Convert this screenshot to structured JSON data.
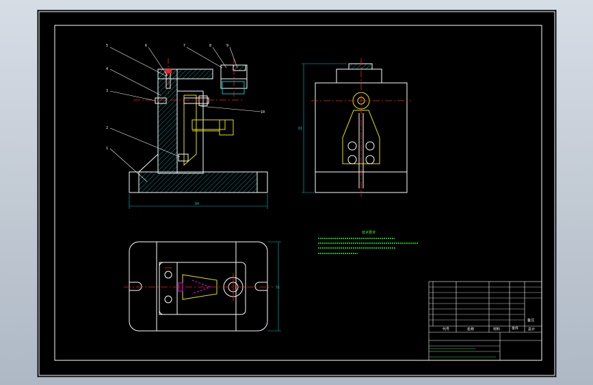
{
  "colors": {
    "background": "#000000",
    "frame": "#ffffff",
    "part_lines": "#ffffff",
    "hatch": "#00c8c8",
    "dimensions": "#00c8c8",
    "centerlines": "#ff2020",
    "subassembly": "#e8e800",
    "hidden": "#ff00ff",
    "notes_text": "#20ff20",
    "title_block": "#ffffff"
  },
  "front_view": {
    "balloons": [
      {
        "id": "b5",
        "label": "5"
      },
      {
        "id": "b6",
        "label": "6"
      },
      {
        "id": "b7",
        "label": "7"
      },
      {
        "id": "b8",
        "label": "8"
      },
      {
        "id": "b9",
        "label": "9"
      },
      {
        "id": "b4",
        "label": "4"
      },
      {
        "id": "b3",
        "label": "3"
      },
      {
        "id": "b10",
        "label": "10"
      },
      {
        "id": "b2",
        "label": "2"
      },
      {
        "id": "b1",
        "label": "1"
      }
    ],
    "width_dimension": "84"
  },
  "side_view": {
    "height_dimension": "81"
  },
  "top_view": {
    "depth_dimension": "51"
  },
  "notes": {
    "title": "技术要求"
  },
  "title_block": {
    "header_cells": [
      "代号",
      "名称",
      "材料",
      "单件",
      "总计"
    ],
    "remark": "备注"
  }
}
